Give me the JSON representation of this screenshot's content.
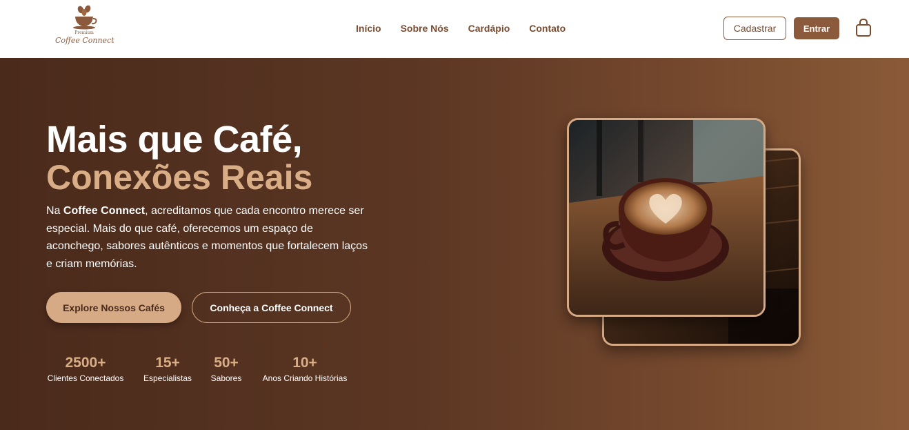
{
  "brand": {
    "tagline": "Premium",
    "name": "Coffee Connect"
  },
  "nav": {
    "items": [
      "Início",
      "Sobre Nós",
      "Cardápio",
      "Contato"
    ]
  },
  "header": {
    "signup_label": "Cadastrar",
    "login_label": "Entrar",
    "cart_icon": "shopping-bag-icon"
  },
  "hero": {
    "title_line1": "Mais que Café,",
    "title_line2": "Conexões Reais",
    "desc_prefix": "Na ",
    "desc_brand": "Coffee Connect",
    "desc_rest": ", acreditamos que cada encontro merece ser especial. Mais do que café, oferecemos um espaço de aconchego, sabores autênticos e momentos que fortalecem laços e criam memórias.",
    "primary_cta": "Explore Nossos Cafés",
    "secondary_cta": "Conheça a Coffee Connect"
  },
  "stats": [
    {
      "value": "2500+",
      "label": "Clientes Conectados"
    },
    {
      "value": "15+",
      "label": "Especialistas"
    },
    {
      "value": "50+",
      "label": "Sabores"
    },
    {
      "value": "10+",
      "label": "Anos Criando Histórias"
    }
  ],
  "colors": {
    "accent": "#8b5a3c",
    "gold": "#d9ae86",
    "hero_dark": "#4a2a1b",
    "hero_light": "#8a5a38"
  }
}
